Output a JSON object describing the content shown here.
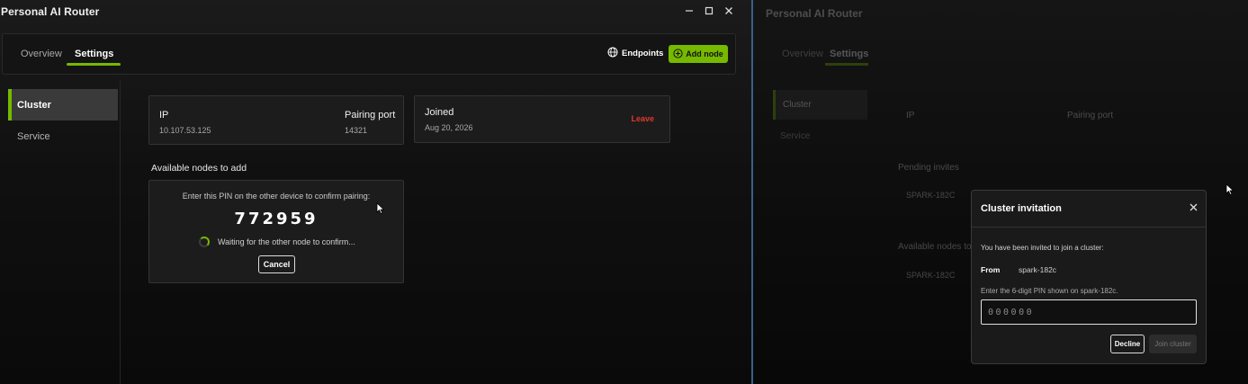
{
  "app": {
    "title": "Personal AI Router",
    "accent_color": "#76b900",
    "danger_color": "#e0392b"
  },
  "window_controls": {
    "minimize_icon": "minimize-icon",
    "maximize_icon": "maximize-icon",
    "close_icon": "close-icon"
  },
  "tabs": [
    {
      "label": "Overview",
      "active": false
    },
    {
      "label": "Settings",
      "active": true
    }
  ],
  "toolbar": {
    "endpoints_label": "Endpoints",
    "endpoints_icon": "globe-icon",
    "add_node_label": "Add node",
    "add_node_icon": "plus-circle-icon"
  },
  "sidebar": {
    "items": [
      {
        "label": "Cluster",
        "active": true
      },
      {
        "label": "Service",
        "active": false
      }
    ]
  },
  "ip_card": {
    "ip_label": "IP",
    "ip_value": "10.107.53.125",
    "port_label": "Pairing port",
    "port_value": "14321"
  },
  "joined_card": {
    "label": "Joined",
    "date": "Aug 20, 2026",
    "leave_label": "Leave"
  },
  "available": {
    "title": "Available nodes to add"
  },
  "pairing": {
    "hint": "Enter this PIN on the other device to confirm pairing:",
    "pin": "772959",
    "waiting": "Waiting for the other node to confirm...",
    "cancel_label": "Cancel"
  },
  "right_window": {
    "title": "Personal AI Router",
    "tab_overview": "Overview",
    "tab_settings": "Settings",
    "side_cluster": "Cluster",
    "side_service": "Service",
    "ip_label": "IP",
    "port_label": "Pairing port",
    "pending_title": "Pending invites",
    "pending_node": "SPARK-182C",
    "available_title": "Available nodes to a",
    "available_node": "SPARK-182C"
  },
  "invitation": {
    "title": "Cluster invitation",
    "intro": "You have been invited to join a cluster:",
    "from_label": "From",
    "from_value": "spark-182c",
    "pin_hint": "Enter the 6-digit PIN shown on spark-182c.",
    "pin_placeholder": "000000",
    "decline_label": "Decline",
    "join_label": "Join cluster"
  }
}
